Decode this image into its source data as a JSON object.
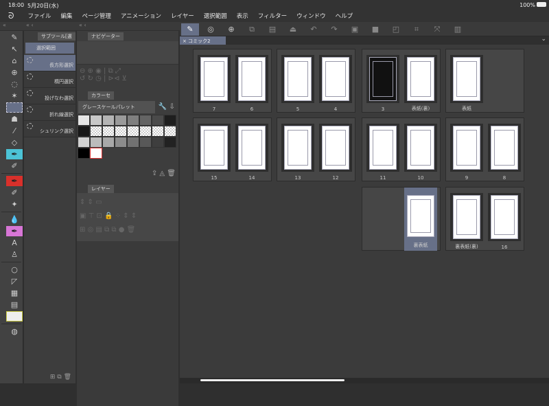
{
  "status": {
    "time": "18:00",
    "date": "5月20日(水)",
    "battery": "100%"
  },
  "menu": [
    "ファイル",
    "編集",
    "ページ管理",
    "アニメーション",
    "レイヤー",
    "選択範囲",
    "表示",
    "フィルター",
    "ウィンドウ",
    "ヘルプ"
  ],
  "subtool": {
    "tab": "サブツール[選",
    "group": "選択範囲",
    "items": [
      "長方形選択",
      "楕円選択",
      "投げなわ選択",
      "折れ線選択",
      "シュリンク選択"
    ]
  },
  "navigator": {
    "tab": "ナビゲーター"
  },
  "color": {
    "tab": "カラーセ",
    "palette": "グレースケールパレット",
    "swatches": [
      "#e6e6e6",
      "#c8c8c8",
      "#b4b4b4",
      "#9a9a9a",
      "#7f7f7f",
      "#646464",
      "#4a4a4a",
      "#1e1e1e",
      "#181818",
      "checker",
      "checker",
      "checker",
      "checker",
      "checker",
      "checker",
      "checker",
      "#d2d2d2",
      "#bcbcbc",
      "#a8a8a8",
      "#8c8c8c",
      "#727272",
      "#585858",
      "#3e3e3e",
      "#222222",
      "#000000",
      "#ffffff"
    ]
  },
  "layer": {
    "tab": "レイヤー"
  },
  "doc_tab": "コミック2",
  "spreads": [
    [
      {
        "label": "7"
      },
      {
        "label": "6"
      }
    ],
    [
      {
        "label": "5"
      },
      {
        "label": "4"
      }
    ],
    [
      {
        "label": "3",
        "dark": true
      },
      {
        "label": "表紙(裏)"
      }
    ],
    [
      {
        "label": "表紙"
      },
      null
    ],
    [
      {
        "label": "15"
      },
      {
        "label": "14"
      }
    ],
    [
      {
        "label": "13"
      },
      {
        "label": "12"
      }
    ],
    [
      {
        "label": "11"
      },
      {
        "label": "10"
      }
    ],
    [
      {
        "label": "9"
      },
      {
        "label": "8"
      }
    ],
    null,
    null,
    [
      null,
      {
        "label": "裏表紙",
        "selected": true
      }
    ],
    [
      {
        "label": "裏表紙(裏)"
      },
      {
        "label": "16"
      }
    ]
  ],
  "accent": "#677088"
}
